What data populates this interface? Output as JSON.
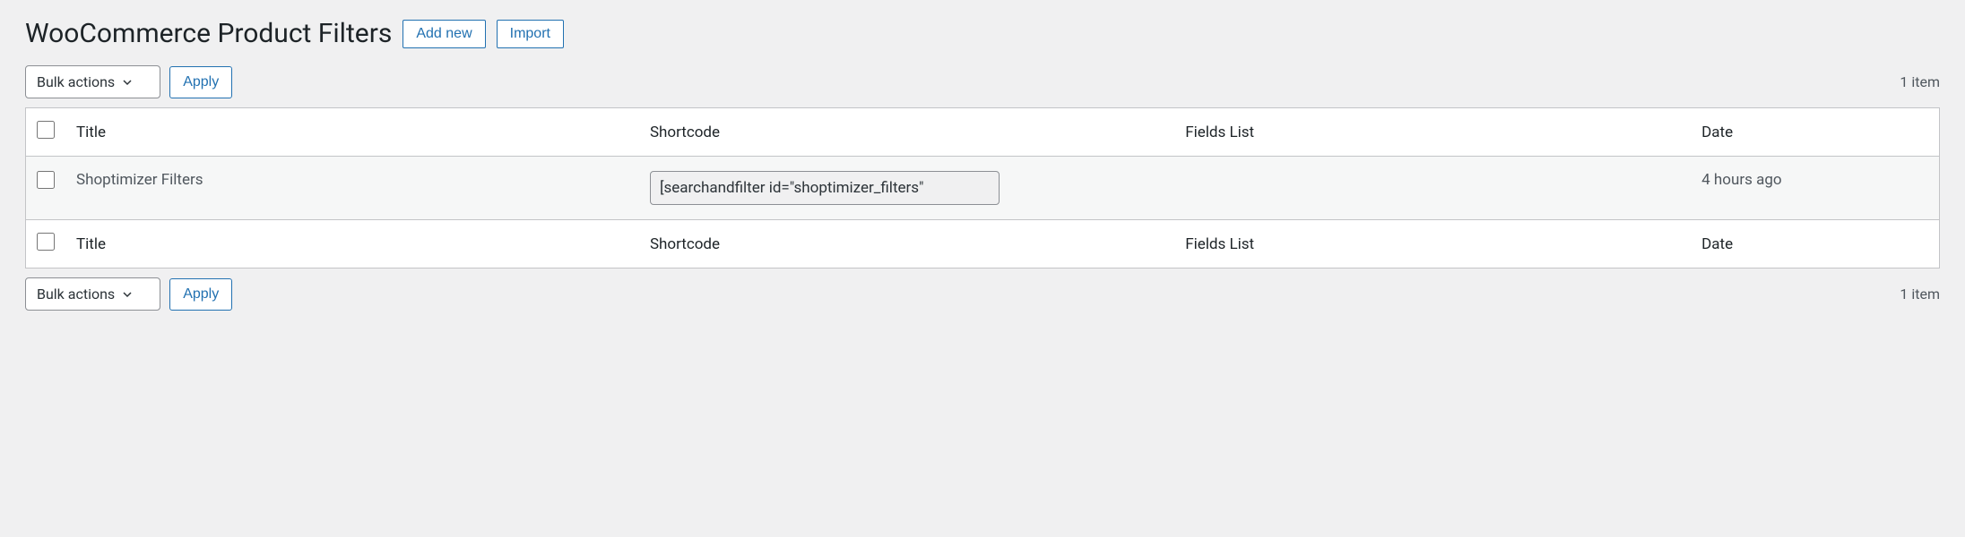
{
  "header": {
    "title": "WooCommerce Product Filters",
    "add_new_label": "Add new",
    "import_label": "Import"
  },
  "bulk": {
    "select_label": "Bulk actions",
    "apply_label": "Apply"
  },
  "pagination": {
    "count_text": "1 item"
  },
  "table": {
    "columns": {
      "title": "Title",
      "shortcode": "Shortcode",
      "fields_list": "Fields List",
      "date": "Date"
    },
    "rows": [
      {
        "title": "Shoptimizer Filters",
        "shortcode": "[searchandfilter id=\"shoptimizer_filters\"",
        "fields_list": "",
        "date": "4 hours ago"
      }
    ]
  }
}
